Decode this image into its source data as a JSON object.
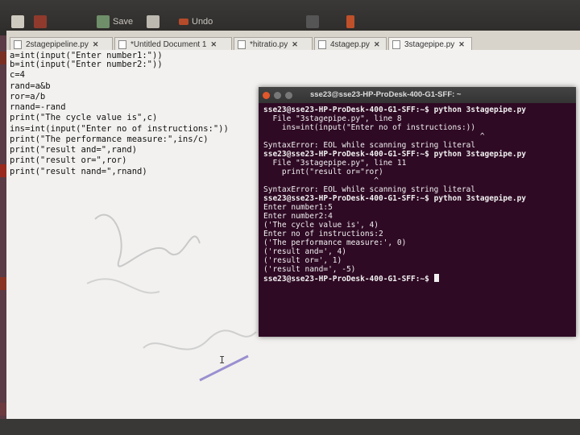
{
  "toolbar": {
    "save_label": "Save",
    "undo_label": "Undo"
  },
  "tabs": [
    {
      "label": "2stagepipeline.py"
    },
    {
      "label": "*Untitled Document 1"
    },
    {
      "label": "*hitratio.py"
    },
    {
      "label": "4stagep.py"
    },
    {
      "label": "3stagepipe.py"
    }
  ],
  "tab_close": "✕",
  "editor": {
    "lines": [
      "a=int(input(\"Enter number1:\"))",
      "b=int(input(\"Enter number2:\"))",
      "c=4",
      "rand=a&b",
      "ror=a/b",
      "rnand=-rand",
      "print(\"The cycle value is\",c)",
      "ins=int(input(\"Enter no of instructions:\"))",
      "print(\"The performance measure:\",ins/c)",
      "print(\"result and=\",rand)",
      "print(\"result or=\",ror)",
      "print(\"result nand=\",rnand)"
    ]
  },
  "terminal": {
    "title": "sse23@sse23-HP-ProDesk-400-G1-SFF: ~",
    "lines": [
      "sse23@sse23-HP-ProDesk-400-G1-SFF:~$ python 3stagepipe.py",
      "  File \"3stagepipe.py\", line 8",
      "    ins=int(input(\"Enter no of instructions:))",
      "                                               ^",
      "SyntaxError: EOL while scanning string literal",
      "sse23@sse23-HP-ProDesk-400-G1-SFF:~$ python 3stagepipe.py",
      "  File \"3stagepipe.py\", line 11",
      "    print(\"result or=\"ror)",
      "                        ^",
      "SyntaxError: EOL while scanning string literal",
      "sse23@sse23-HP-ProDesk-400-G1-SFF:~$ python 3stagepipe.py",
      "Enter number1:5",
      "Enter number2:4",
      "('The cycle value is', 4)",
      "Enter no of instructions:2",
      "('The performance measure:', 0)",
      "('result and=', 4)",
      "('result or=', 1)",
      "('result nand=', -5)",
      "sse23@sse23-HP-ProDesk-400-G1-SFF:~$ "
    ]
  },
  "colors": {
    "terminal_bg": "#2f0a24",
    "editor_bg": "#f2f1ef",
    "launcher": "#5b3b45"
  }
}
